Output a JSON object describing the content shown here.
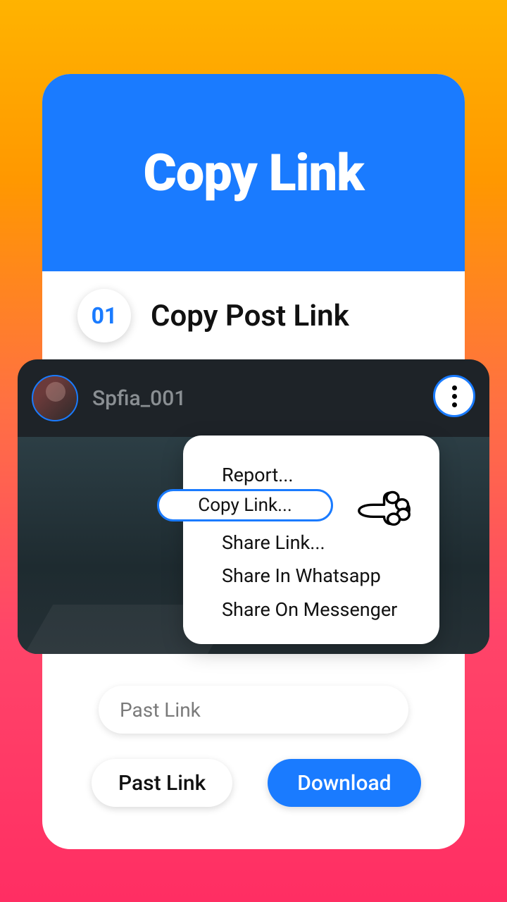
{
  "header": {
    "title": "Copy Link"
  },
  "step": {
    "number": "01",
    "title": "Copy Post Link"
  },
  "mock": {
    "username": "Spfia_001"
  },
  "popup": {
    "items": [
      "Report...",
      "Copy Link...",
      "Share Link...",
      "Share In Whatsapp",
      "Share On Messenger"
    ],
    "highlighted": "Copy Link..."
  },
  "input": {
    "placeholder": "Past Link"
  },
  "buttons": {
    "past": "Past Link",
    "download": "Download"
  }
}
